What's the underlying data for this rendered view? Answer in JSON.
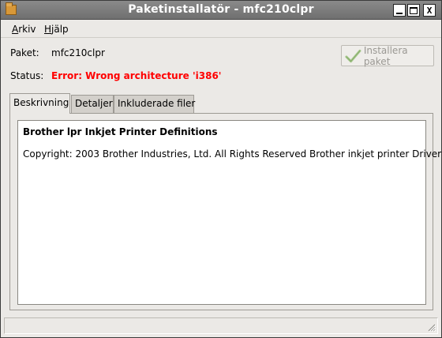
{
  "window": {
    "title": "Paketinstallatör - mfc210clpr",
    "controls": {
      "minimize": "minimize",
      "maximize": "maximize",
      "close": "X"
    }
  },
  "menu": {
    "arkiv": {
      "mnemonic": "A",
      "rest": "rkiv"
    },
    "hjalp": {
      "mnemonic": "H",
      "rest": "jälp"
    }
  },
  "info": {
    "paket_label": "Paket:",
    "paket_value": "mfc210clpr",
    "status_label": "Status:",
    "status_value": "Error: Wrong architecture 'i386'",
    "status_color": "#ff0000"
  },
  "install_button": {
    "label": "Installera paket",
    "enabled": false
  },
  "tabs": [
    {
      "label": "Beskrivning",
      "active": true
    },
    {
      "label": "Detaljer",
      "active": false
    },
    {
      "label": "Inkluderade filer",
      "active": false
    }
  ],
  "description": {
    "title": "Brother lpr Inkjet Printer Definitions",
    "body": "Copyright: 2003 Brother Industries, Ltd. All Rights Reserved Brother inkjet printer Driver"
  }
}
